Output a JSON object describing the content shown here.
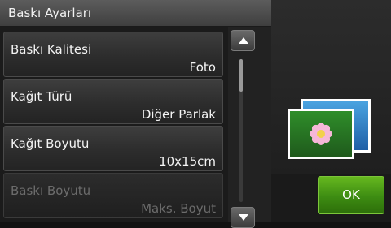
{
  "header": {
    "title": "Baskı Ayarları"
  },
  "settings": [
    {
      "label": "Baskı Kalitesi",
      "value": "Foto"
    },
    {
      "label": "Kağıt Türü",
      "value": "Diğer Parlak"
    },
    {
      "label": "Kağıt Boyutu",
      "value": "10x15cm"
    },
    {
      "label": "Baskı Boyutu",
      "value": "Maks. Boyut",
      "disabled": true
    }
  ],
  "scroll": {
    "up_icon": "triangle-up",
    "down_icon": "triangle-down",
    "position": 0.0
  },
  "preview": {
    "icon": "photo-flower-icon"
  },
  "ok_button": {
    "label": "OK",
    "color": "#4a9a18"
  }
}
